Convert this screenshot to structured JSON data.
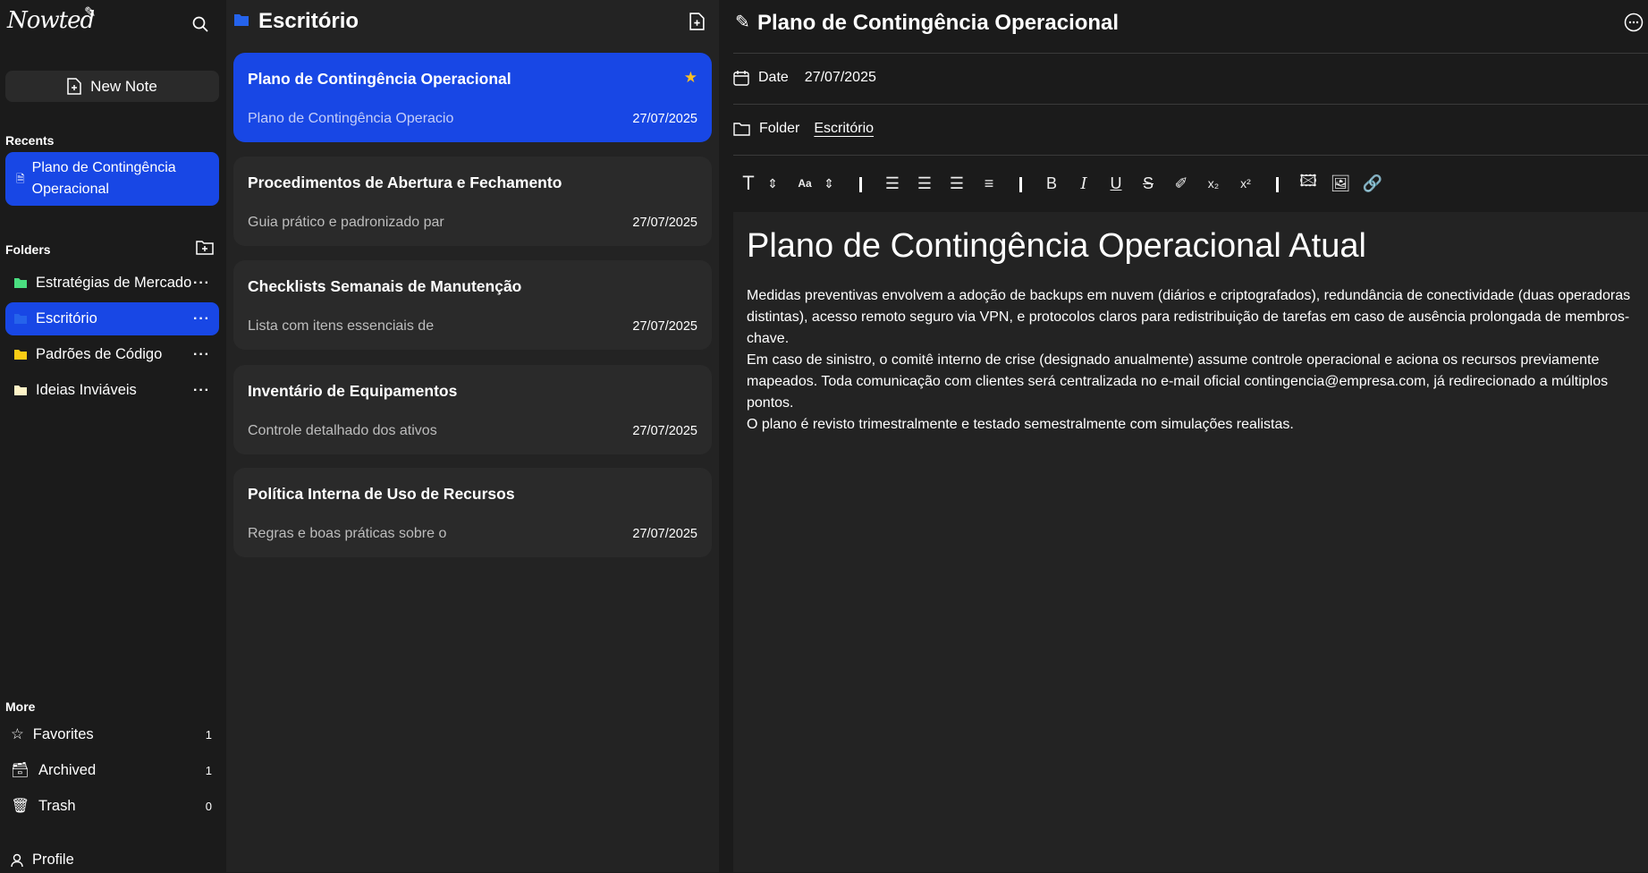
{
  "app": {
    "logo": "Nowted"
  },
  "sidebar": {
    "new_note": "New Note",
    "recents_label": "Recents",
    "recents": [
      {
        "label": "Plano de Contingência Operacional"
      }
    ],
    "folders_label": "Folders",
    "folders": [
      {
        "label": "Estratégias de Mercado",
        "color": "#4ade80"
      },
      {
        "label": "Escritório",
        "color": "#2563eb",
        "active": true
      },
      {
        "label": "Padrões de Código",
        "color": "#facc15"
      },
      {
        "label": "Ideias Inviáveis",
        "color": "#fef3c7"
      }
    ],
    "more_label": "More",
    "more": [
      {
        "label": "Favorites",
        "count": "1",
        "icon": "star-icon"
      },
      {
        "label": "Archived",
        "count": "1",
        "icon": "archive-icon"
      },
      {
        "label": "Trash",
        "count": "0",
        "icon": "trash-icon"
      }
    ],
    "profile": "Profile"
  },
  "notes_list": {
    "folder_title": "Escritório",
    "notes": [
      {
        "title": "Plano de Contingência Operacional",
        "snippet": "Plano de Contingência Operacio",
        "date": "27/07/2025",
        "favorite": true,
        "active": true
      },
      {
        "title": "Procedimentos de Abertura e Fechamento",
        "snippet": "Guia prático e padronizado par",
        "date": "27/07/2025"
      },
      {
        "title": "Checklists Semanais de Manutenção",
        "snippet": "Lista com itens essenciais de",
        "date": "27/07/2025"
      },
      {
        "title": "Inventário de Equipamentos",
        "snippet": "Controle detalhado dos ativos",
        "date": "27/07/2025"
      },
      {
        "title": "Política Interna de Uso de Recursos",
        "snippet": "Regras e boas práticas sobre o",
        "date": "27/07/2025"
      }
    ]
  },
  "editor": {
    "title": "Plano de Contingência Operacional",
    "date_label": "Date",
    "date": "27/07/2025",
    "folder_label": "Folder",
    "folder": "Escritório",
    "heading": "Plano de Contingência Operacional Atual",
    "paragraphs": [
      "Medidas preventivas envolvem a adoção de backups em nuvem (diários e criptografados), redundância de conectividade (duas operadoras distintas), acesso remoto seguro via VPN, e protocolos claros para redistribuição de tarefas em caso de ausência prolongada de membros-chave.",
      "Em caso de sinistro, o comitê interno de crise (designado anualmente) assume controle operacional e aciona os recursos previamente mapeados. Toda comunicação com clientes será centralizada no e-mail oficial contingencia@empresa.com, já redirecionado a múltiplos pontos.",
      "O plano é revisto trimestralmente e testado semestralmente com simulações realistas."
    ]
  },
  "colors": {
    "accent": "#1847e5",
    "star": "#fbbf24"
  }
}
